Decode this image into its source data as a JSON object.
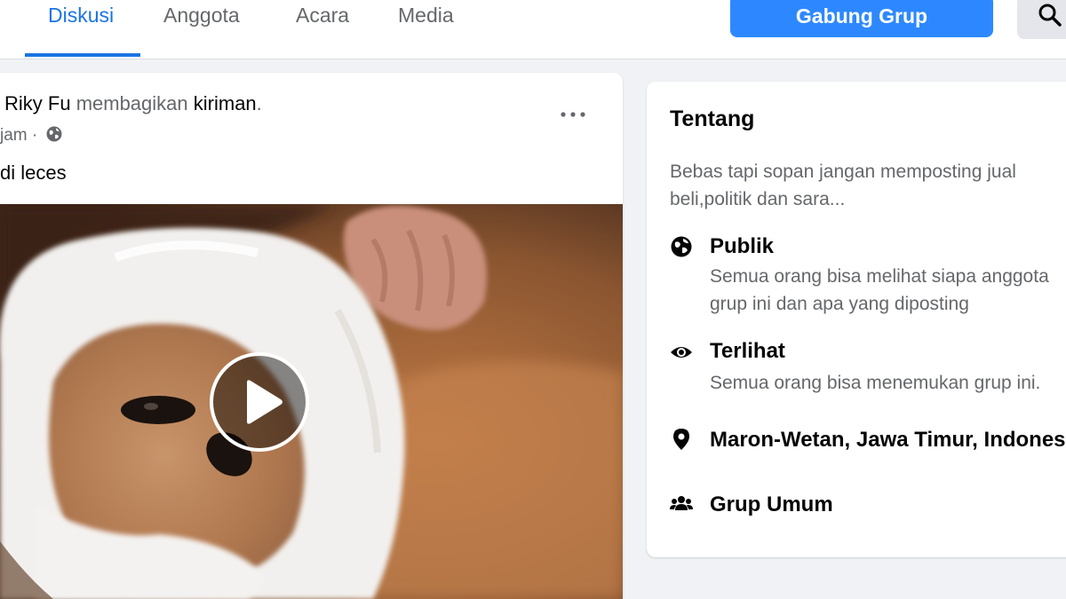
{
  "tabs": [
    {
      "label": "Diskusi",
      "active": true
    },
    {
      "label": "Anggota",
      "active": false
    },
    {
      "label": "Acara",
      "active": false
    },
    {
      "label": "Media",
      "active": false
    }
  ],
  "header": {
    "join_label": "Gabung Grup",
    "search_icon": "search-icon"
  },
  "post": {
    "author": "Riky Fu",
    "action": "membagikan",
    "object": "kiriman",
    "time": "jam",
    "privacy_icon": "globe-icon",
    "text": "di leces",
    "more_icon": "more-dots-icon",
    "media_type": "video"
  },
  "about": {
    "title": "Tentang",
    "description_line1": "Bebas tapi sopan jangan memposting jual",
    "description_line2": "beli,politik dan sara...",
    "items": [
      {
        "icon": "globe-icon",
        "title": "Publik",
        "lines": [
          "Semua orang bisa melihat siapa anggota",
          "grup ini dan apa yang diposting"
        ]
      },
      {
        "icon": "eye-icon",
        "title": "Terlihat",
        "lines": [
          "Semua orang bisa menemukan grup ini."
        ]
      },
      {
        "icon": "location-pin-icon",
        "title": "Maron-Wetan, Jawa Timur, Indonesia",
        "lines": []
      },
      {
        "icon": "people-icon",
        "title": "Grup Umum",
        "lines": []
      }
    ]
  },
  "colors": {
    "accent": "#1b74e4",
    "button": "#2d88ff",
    "background": "#f0f2f5",
    "secondary_text": "#65676b"
  }
}
